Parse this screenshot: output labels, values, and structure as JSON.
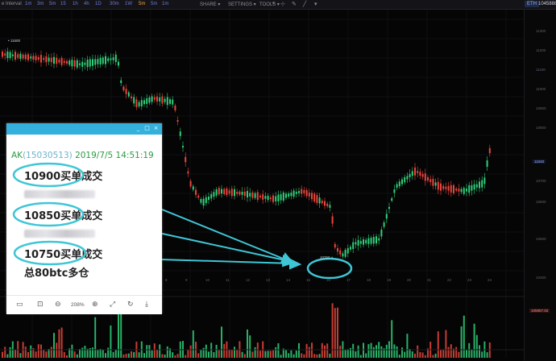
{
  "toolbar": {
    "symbol": "e Interval",
    "timeframes": [
      "1m",
      "3m",
      "5m",
      "15",
      "1h",
      "4h",
      "1D",
      "30m",
      "1W",
      "5m",
      "5m",
      "1m"
    ],
    "active_timeframe_index": 9,
    "menus": [
      "SHARE ▾",
      "SETTINGS ▾",
      "TOOLS ▾"
    ],
    "price_pill": "ETH",
    "right_value": "10458882"
  },
  "chart": {
    "top_price_label": "• 11500",
    "marker_label": "10750 +",
    "price_axis_labels": [
      "11300",
      "11200",
      "11100",
      "11000",
      "10900",
      "10800",
      "10700",
      "10600",
      "10500",
      "10400"
    ],
    "last_price": "11040",
    "x_axis_labels": [
      "Jul 5",
      "2",
      "3",
      "4",
      "5",
      "6",
      "7",
      "8",
      "9",
      "10",
      "11",
      "12",
      "13",
      "14",
      "15",
      "16",
      "17",
      "18",
      "19",
      "20",
      "21",
      "22",
      "23",
      "24"
    ],
    "volume_label": "105957.02"
  },
  "popup": {
    "window_controls": [
      "_",
      "□",
      "×"
    ],
    "sender_name": "AK",
    "sender_qq": "(15030513)",
    "sender_datetime": "2019/7/5 14:51:19",
    "messages": [
      "10900买单成交",
      "10850买单成交",
      "10750买单成交",
      "总80btc多仓"
    ],
    "zoom": "208%",
    "tools": [
      "▭",
      "⊡",
      "⊖",
      "⊕",
      "⤢",
      "↻",
      "⤓"
    ]
  },
  "colors": {
    "up": "#2fd07a",
    "down": "#e8463c",
    "highlight": "#3fc6d6",
    "titlebar": "#34b0dc"
  }
}
